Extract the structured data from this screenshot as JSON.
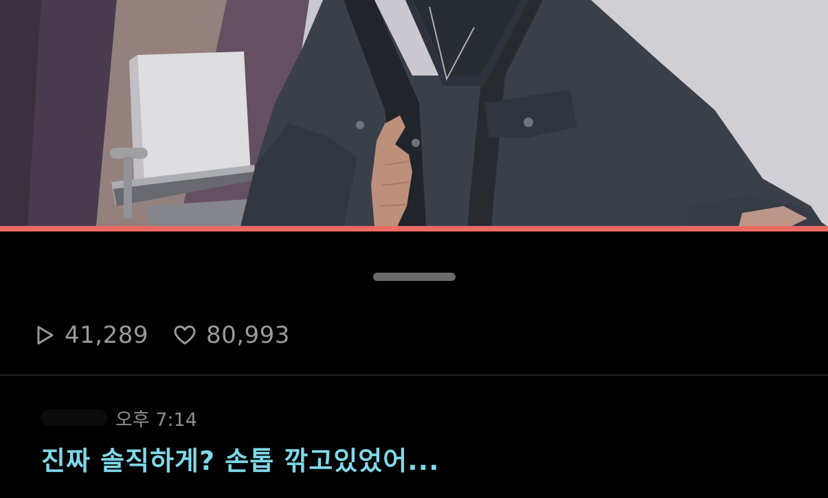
{
  "video": {
    "progress_percent": 100,
    "progress_color": "#ef6a63"
  },
  "stats": {
    "plays": "41,289",
    "likes": "80,993",
    "play_icon": "play-icon",
    "like_icon": "heart-icon"
  },
  "comment": {
    "time": "오후 7:14",
    "text": "진짜 솔직하게? 손톱 깎고있었어..."
  },
  "colors": {
    "background": "#000000",
    "stats_text": "#9a9a9a",
    "comment_text": "#7fd8ea",
    "time_text": "#8e8e8e"
  }
}
